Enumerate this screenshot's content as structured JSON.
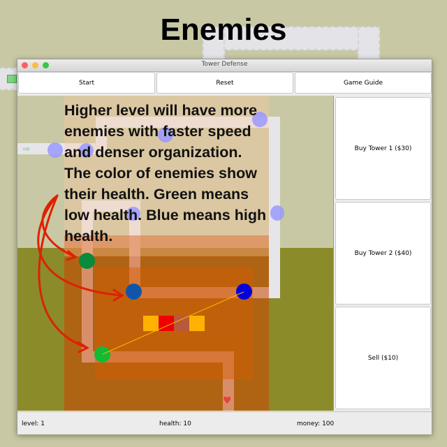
{
  "page": {
    "title": "Enemies"
  },
  "window": {
    "title": "Tower Defense"
  },
  "toolbar": {
    "start_label": "Start",
    "reset_label": "Reset",
    "guide_label": "Game Guide"
  },
  "sidebar": {
    "buy_tower_1_label": "Buy Tower 1 ($30)",
    "buy_tower_2_label": "Buy Tower 2 ($40)",
    "sell_label": "Sell ($10)"
  },
  "status": {
    "level": "level: 1",
    "health": "health: 10",
    "money": "money: 100"
  },
  "annotation": {
    "lines": [
      "Higher level will have more",
      "enemies with faster speed",
      "and denser organization.",
      "The color of enemies show",
      "their health. Green means",
      "low health. Blue means high",
      "health."
    ]
  },
  "colors": {
    "enemy_full_health": "#9999ff",
    "enemy_mid_health": "#1155aa",
    "enemy_low_health": "#1aa04a",
    "enemy_near_dead": "#0a8a3a",
    "enemy_high_health": "#0000dd",
    "tower_range_fill": "#c84a00",
    "tower_yellow": "#ffb300",
    "tower_red": "#ee0000",
    "arrow": "#dd2200",
    "field_grass": "#c8c8a4",
    "field_lower": "#8b8b2a"
  }
}
